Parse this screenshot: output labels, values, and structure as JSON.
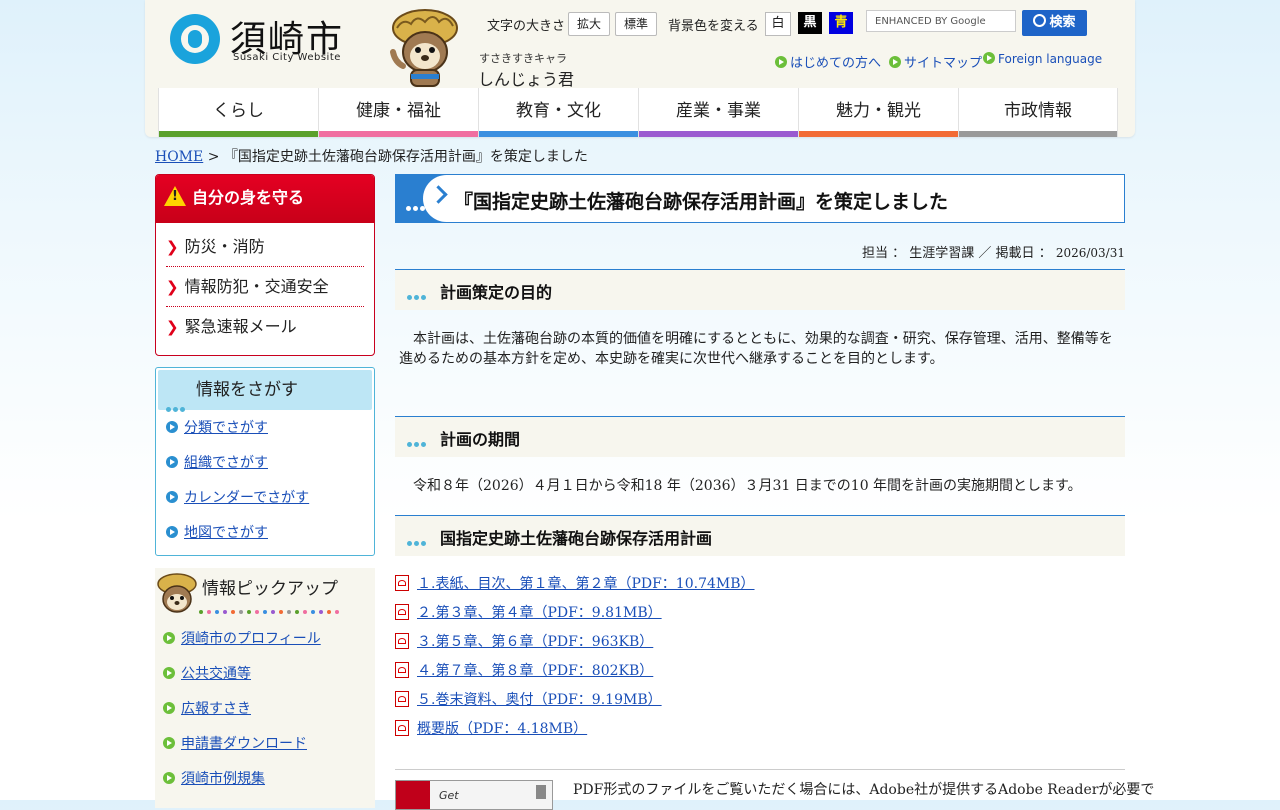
{
  "header": {
    "logo_text": "須崎市",
    "logo_sub": "Susaki City Website",
    "mascot_caption1": "すさきすきキャラ",
    "mascot_caption2": "しんじょう君",
    "text_size_label": "文字の大きさ",
    "enlarge_label": "拡大",
    "standard_label": "標準",
    "bg_color_label": "背景色を変える",
    "bg_white": "白",
    "bg_black": "黒",
    "bg_blue": "青",
    "search_placeholder": "ENHANCED BY Google",
    "search_button": "検索",
    "links": [
      "はじめての方へ",
      "サイトマップ",
      "Foreign language"
    ]
  },
  "nav": {
    "items": [
      {
        "label": "くらし",
        "color": "#5aa02c"
      },
      {
        "label": "健康・福祉",
        "color": "#f06ea0"
      },
      {
        "label": "教育・文化",
        "color": "#3a8fe0"
      },
      {
        "label": "産業・事業",
        "color": "#9a5ad0"
      },
      {
        "label": "魅力・観光",
        "color": "#f26b35"
      },
      {
        "label": "市政情報",
        "color": "#999999"
      }
    ]
  },
  "breadcrumb": {
    "home": "HOME",
    "separator": ">",
    "current": "『国指定史跡土佐藩砲台跡保存活用計画』を策定しました"
  },
  "sidebar": {
    "protect": {
      "title": "自分の身を守る",
      "items": [
        "防災・消防",
        "情報防犯・交通安全",
        "緊急速報メール"
      ]
    },
    "search": {
      "title": "情報をさがす",
      "items": [
        "分類でさがす",
        "組織でさがす",
        "カレンダーでさがす",
        "地図でさがす"
      ]
    },
    "pickup": {
      "title": "情報ピックアップ",
      "items": [
        "須崎市のプロフィール",
        "公共交通等",
        "広報すさき",
        "申請書ダウンロード",
        "須崎市例規集"
      ]
    }
  },
  "main": {
    "title": "『国指定史跡土佐藩砲台跡保存活用計画』を策定しました",
    "meta_prefix": "担当 ： 生涯学習課 ／ 掲載日 ： ",
    "meta_date": "2026/03/31",
    "section1": {
      "heading": "計画策定の目的",
      "body": "　本計画は、土佐藩砲台跡の本質的価値を明確にするとともに、効果的な調査・研究、保存管理、活用、整備等を進めるための基本方針を定め、本史跡を確実に次世代へ継承することを目的とします。"
    },
    "section2": {
      "heading": "計画の期間",
      "body": "　令和８年（2026）４月１日から令和18 年（2036）３月31 日までの10 年間を計画の実施期間とします。"
    },
    "section3": {
      "heading": "国指定史跡土佐藩砲台跡保存活用計画",
      "files": [
        "１.表紙、目次、第１章、第２章（PDF：10.74MB）",
        "２.第３章、第４章（PDF：9.81MB）",
        "３.第５章、第６章（PDF：963KB）",
        "４.第７章、第８章（PDF：802KB）",
        "５.巻末資料、奥付（PDF：9.19MB）",
        "概要版（PDF：4.18MB）"
      ]
    },
    "get_label": "Get",
    "pdf_note": "PDF形式のファイルをご覧いただく場合には、Adobe社が提供するAdobe Readerが必要で"
  }
}
